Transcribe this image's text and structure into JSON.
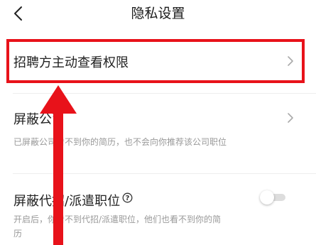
{
  "header": {
    "title": "隐私设置",
    "back_icon": "chevron-left-icon"
  },
  "settings": {
    "recruiter_access": {
      "label": "招聘方主动查看权限",
      "icon": "chevron-right-icon"
    },
    "block_companies": {
      "label": "屏蔽公司",
      "description": "已屏蔽公司看不到你的简历，也不会向你推荐该公司职位",
      "icon": "chevron-right-icon"
    },
    "block_agency_jobs": {
      "label": "屏蔽代招/派遣职位",
      "description": "开启后，你看不到代招/派遣职位，他们也看不到你的简历",
      "help_icon": "question-circle-icon",
      "toggle_on": false
    }
  },
  "annotation": {
    "highlight_color": "#e8121a",
    "arrow_icon": "arrow-up-icon"
  }
}
